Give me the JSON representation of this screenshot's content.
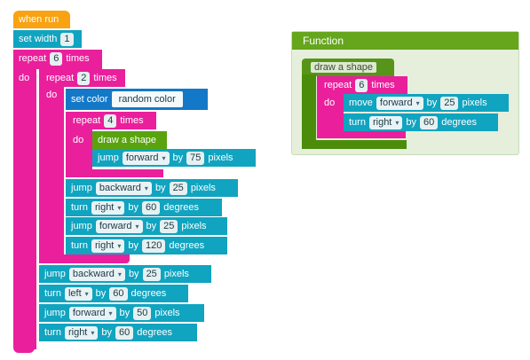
{
  "program": {
    "event_label": "when run",
    "set_width": {
      "label": "set width",
      "value": "1"
    },
    "outer_repeat": {
      "label": "repeat",
      "count": "6",
      "suffix": "times",
      "do": "do"
    },
    "inner_repeat": {
      "label": "repeat",
      "count": "2",
      "suffix": "times",
      "do": "do"
    },
    "set_color": {
      "label": "set color",
      "value": "random color"
    },
    "petal_repeat": {
      "label": "repeat",
      "count": "4",
      "suffix": "times",
      "do": "do"
    },
    "draw_call": "draw a shape",
    "jump_1": {
      "label": "jump",
      "dir": "forward",
      "by": "by",
      "value": "75",
      "unit": "pixels"
    },
    "jump_2": {
      "label": "jump",
      "dir": "backward",
      "by": "by",
      "value": "25",
      "unit": "pixels"
    },
    "turn_1": {
      "label": "turn",
      "dir": "right",
      "by": "by",
      "value": "60",
      "unit": "degrees"
    },
    "jump_3": {
      "label": "jump",
      "dir": "forward",
      "by": "by",
      "value": "25",
      "unit": "pixels"
    },
    "turn_2": {
      "label": "turn",
      "dir": "right",
      "by": "by",
      "value": "120",
      "unit": "degrees"
    },
    "jump_4": {
      "label": "jump",
      "dir": "backward",
      "by": "by",
      "value": "25",
      "unit": "pixels"
    },
    "turn_3": {
      "label": "turn",
      "dir": "left",
      "by": "by",
      "value": "60",
      "unit": "degrees"
    },
    "jump_5": {
      "label": "jump",
      "dir": "forward",
      "by": "by",
      "value": "50",
      "unit": "pixels"
    },
    "turn_4": {
      "label": "turn",
      "dir": "right",
      "by": "by",
      "value": "60",
      "unit": "degrees"
    }
  },
  "function_panel": {
    "title": "Function",
    "name": "draw a shape",
    "repeat": {
      "label": "repeat",
      "count": "6",
      "suffix": "times",
      "do": "do"
    },
    "move": {
      "label": "move",
      "dir": "forward",
      "by": "by",
      "value": "25",
      "unit": "pixels"
    },
    "turn": {
      "label": "turn",
      "dir": "right",
      "by": "by",
      "value": "60",
      "unit": "degrees"
    }
  }
}
